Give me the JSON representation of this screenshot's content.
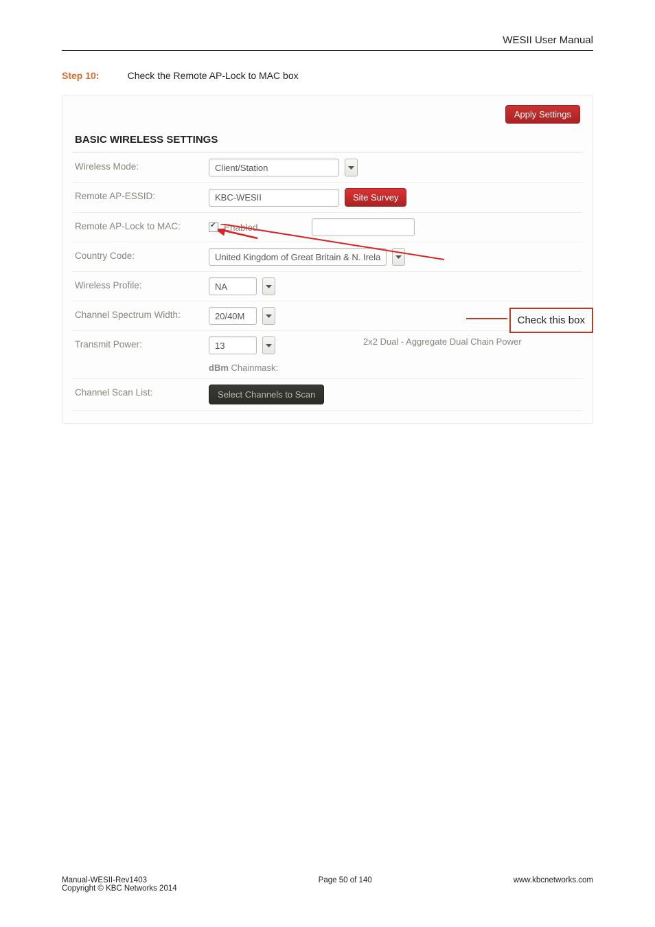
{
  "header": {
    "doc_title": "WESII User Manual"
  },
  "step": {
    "label": "Step 10:",
    "desc": "Check the Remote AP-Lock to MAC box"
  },
  "panel": {
    "apply_btn": "Apply Settings",
    "title": "BASIC WIRELESS SETTINGS",
    "rows": {
      "wireless_mode": {
        "label": "Wireless Mode:",
        "value": "Client/Station"
      },
      "remote_essid": {
        "label": "Remote AP-ESSID:",
        "value": "KBC-WESII",
        "btn": "Site Survey"
      },
      "remote_lock": {
        "label": "Remote AP-Lock to MAC:",
        "enabled_text": "Enabled"
      },
      "country_code": {
        "label": "Country Code:",
        "value": "United Kingdom of Great Britain & N. Irela"
      },
      "wireless_prof": {
        "label": "Wireless Profile:",
        "value": "NA"
      },
      "chan_width": {
        "label": "Channel Spectrum Width:",
        "value": "20/40M"
      },
      "tx_power": {
        "label": "Transmit Power:",
        "value": "13",
        "dbm": "dBm",
        "chainmask": "Chainmask:",
        "right_text": "2x2 Dual - Aggregate Dual Chain Power"
      },
      "scan_list": {
        "label": "Channel Scan List:",
        "btn": "Select Channels to Scan"
      }
    }
  },
  "callout": {
    "text": "Check this box"
  },
  "footer": {
    "left_line1": "Manual-WESII-Rev1403",
    "left_line2": "Copyright © KBC Networks 2014",
    "center": "Page 50 of 140",
    "right": "www.kbcnetworks.com"
  }
}
